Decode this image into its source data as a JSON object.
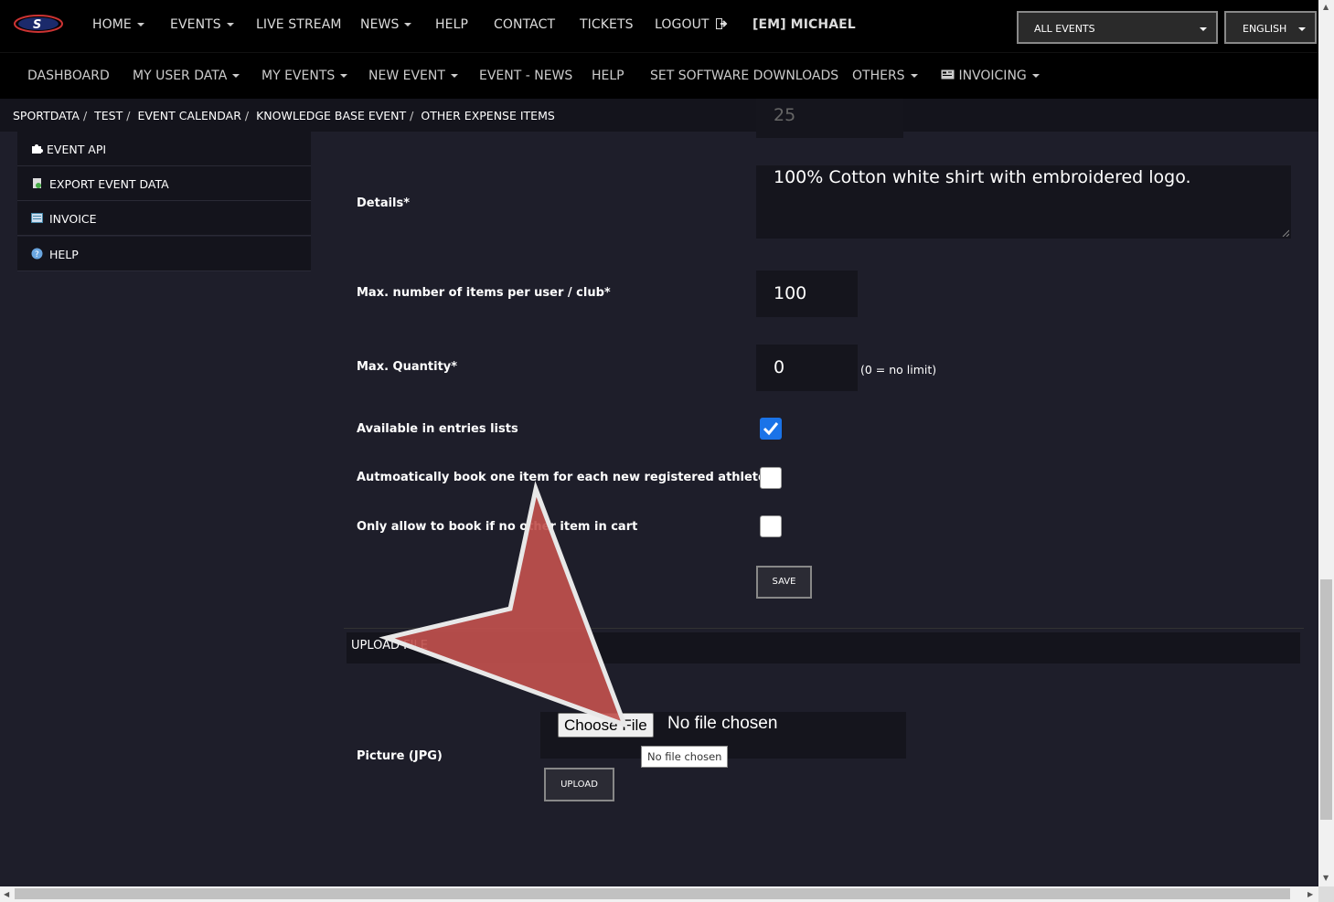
{
  "top_nav": {
    "items": [
      "HOME",
      "EVENTS",
      "LIVE STREAM",
      "NEWS",
      "HELP",
      "CONTACT",
      "TICKETS",
      "LOGOUT"
    ],
    "user": "[EM] MICHAEL",
    "event_select": "ALL EVENTS",
    "language_select": "ENGLISH"
  },
  "second_nav": {
    "items": [
      "DASHBOARD",
      "MY USER DATA",
      "MY EVENTS",
      "NEW EVENT",
      "EVENT - NEWS",
      "HELP",
      "SET SOFTWARE DOWNLOADS",
      "OTHERS",
      "INVOICING"
    ]
  },
  "breadcrumb": [
    "SPORTDATA",
    "TEST",
    "EVENT CALENDAR",
    "KNOWLEDGE BASE EVENT",
    "OTHER EXPENSE ITEMS"
  ],
  "sidebar": {
    "items": [
      {
        "label": "EVENT API",
        "icon": "puzzle-icon"
      },
      {
        "label": "EXPORT EVENT DATA",
        "icon": "export-icon"
      },
      {
        "label": "INVOICE",
        "icon": "invoice-icon"
      },
      {
        "label": "HELP",
        "icon": "help-icon"
      }
    ]
  },
  "form": {
    "price_value": "25",
    "details_label": "Details*",
    "details_value": "100% Cotton white shirt with embroidered logo.",
    "max_items_label": "Max. number of items per user / club*",
    "max_items_value": "100",
    "max_quantity_label": "Max. Quantity*",
    "max_quantity_value": "0",
    "max_quantity_hint": "(0 = no limit)",
    "available_label": "Available in entries lists",
    "available_checked": true,
    "auto_book_label": "Autmoatically book one item for each new registered athlete",
    "auto_book_checked": false,
    "only_allow_label": "Only allow to book if no other item in cart",
    "only_allow_checked": false,
    "save_label": "SAVE"
  },
  "upload": {
    "section_title": "UPLOAD FILE",
    "picture_label": "Picture (JPG)",
    "choose_file_label": "Choose File",
    "file_status": "No file chosen",
    "tooltip": "No file chosen",
    "upload_label": "UPLOAD"
  },
  "colors": {
    "checkbox_checked": "#1a73e8",
    "pointer_arrow": "#c0504d"
  }
}
